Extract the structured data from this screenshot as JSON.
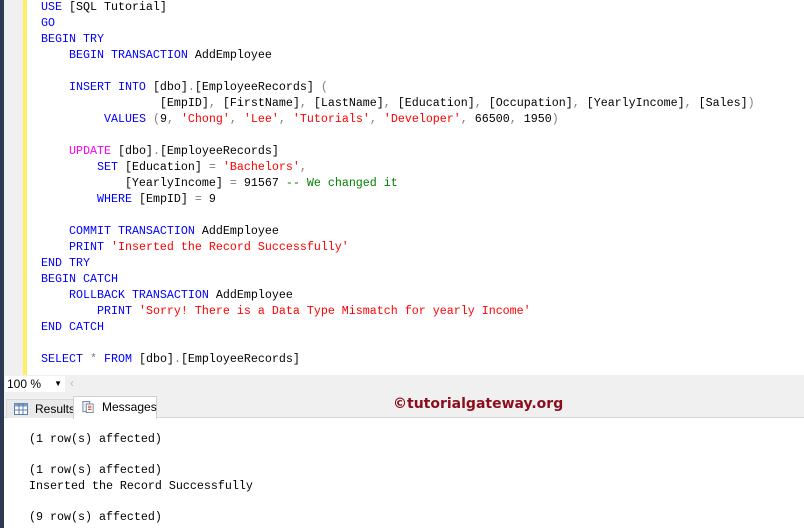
{
  "editor": {
    "lines": [
      [
        [
          "kw",
          "USE "
        ],
        [
          "id",
          "[SQL Tutorial]"
        ]
      ],
      [
        [
          "kw",
          "GO"
        ]
      ],
      [
        [
          "kw",
          "BEGIN TRY"
        ]
      ],
      [
        [
          "id",
          "    "
        ],
        [
          "kw",
          "BEGIN TRANSACTION "
        ],
        [
          "id",
          "AddEmployee"
        ]
      ],
      [],
      [
        [
          "id",
          "    "
        ],
        [
          "kw",
          "INSERT INTO "
        ],
        [
          "id",
          "[dbo]"
        ],
        [
          "op",
          "."
        ],
        [
          "id",
          "[EmployeeRecords] "
        ],
        [
          "op",
          "("
        ]
      ],
      [
        [
          "id",
          "                 [EmpID]"
        ],
        [
          "op",
          ", "
        ],
        [
          "id",
          "[FirstName]"
        ],
        [
          "op",
          ", "
        ],
        [
          "id",
          "[LastName]"
        ],
        [
          "op",
          ", "
        ],
        [
          "id",
          "[Education]"
        ],
        [
          "op",
          ", "
        ],
        [
          "id",
          "[Occupation]"
        ],
        [
          "op",
          ", "
        ],
        [
          "id",
          "[YearlyIncome]"
        ],
        [
          "op",
          ", "
        ],
        [
          "id",
          "[Sales]"
        ],
        [
          "op",
          ")"
        ]
      ],
      [
        [
          "id",
          "         "
        ],
        [
          "kw",
          "VALUES "
        ],
        [
          "op",
          "("
        ],
        [
          "id",
          "9"
        ],
        [
          "op",
          ", "
        ],
        [
          "str",
          "'Chong'"
        ],
        [
          "op",
          ", "
        ],
        [
          "str",
          "'Lee'"
        ],
        [
          "op",
          ", "
        ],
        [
          "str",
          "'Tutorials'"
        ],
        [
          "op",
          ", "
        ],
        [
          "str",
          "'Developer'"
        ],
        [
          "op",
          ", "
        ],
        [
          "id",
          "66500"
        ],
        [
          "op",
          ", "
        ],
        [
          "id",
          "1950"
        ],
        [
          "op",
          ")"
        ]
      ],
      [],
      [
        [
          "id",
          "    "
        ],
        [
          "fn",
          "UPDATE "
        ],
        [
          "id",
          "[dbo]"
        ],
        [
          "op",
          "."
        ],
        [
          "id",
          "[EmployeeRecords]"
        ]
      ],
      [
        [
          "id",
          "        "
        ],
        [
          "kw",
          "SET "
        ],
        [
          "id",
          "[Education] "
        ],
        [
          "op",
          "= "
        ],
        [
          "str",
          "'Bachelors'"
        ],
        [
          "op",
          ","
        ]
      ],
      [
        [
          "id",
          "            [YearlyIncome] "
        ],
        [
          "op",
          "= "
        ],
        [
          "id",
          "91567 "
        ],
        [
          "cm",
          "-- We changed it"
        ]
      ],
      [
        [
          "id",
          "        "
        ],
        [
          "kw",
          "WHERE "
        ],
        [
          "id",
          "[EmpID] "
        ],
        [
          "op",
          "= "
        ],
        [
          "id",
          "9"
        ]
      ],
      [],
      [
        [
          "id",
          "    "
        ],
        [
          "kw",
          "COMMIT TRANSACTION "
        ],
        [
          "id",
          "AddEmployee"
        ]
      ],
      [
        [
          "id",
          "    "
        ],
        [
          "kw",
          "PRINT "
        ],
        [
          "str",
          "'Inserted the Record Successfully'"
        ]
      ],
      [
        [
          "kw",
          "END TRY"
        ]
      ],
      [
        [
          "kw",
          "BEGIN CATCH"
        ]
      ],
      [
        [
          "id",
          "    "
        ],
        [
          "kw",
          "ROLLBACK TRANSACTION "
        ],
        [
          "id",
          "AddEmployee"
        ]
      ],
      [
        [
          "id",
          "        "
        ],
        [
          "kw",
          "PRINT "
        ],
        [
          "str",
          "'Sorry! There is a Data Type Mismatch for yearly Income'"
        ]
      ],
      [
        [
          "kw",
          "END CATCH"
        ]
      ],
      [],
      [
        [
          "kw",
          "SELECT "
        ],
        [
          "op",
          "* "
        ],
        [
          "kw",
          "FROM "
        ],
        [
          "id",
          "[dbo]"
        ],
        [
          "op",
          "."
        ],
        [
          "id",
          "[EmployeeRecords]"
        ]
      ]
    ]
  },
  "zoom": {
    "value": "100 %"
  },
  "tabs": {
    "results": "Results",
    "messages": "Messages"
  },
  "watermark": "©tutorialgateway.org",
  "messages": [
    "(1 row(s) affected)",
    "",
    "(1 row(s) affected)",
    "Inserted the Record Successfully",
    "",
    "(9 row(s) affected)"
  ],
  "colors": {
    "keyword": "#0000ff",
    "string": "#ff0000",
    "comment": "#008000",
    "function": "#ff00ff",
    "watermark": "#8b0e1c"
  }
}
